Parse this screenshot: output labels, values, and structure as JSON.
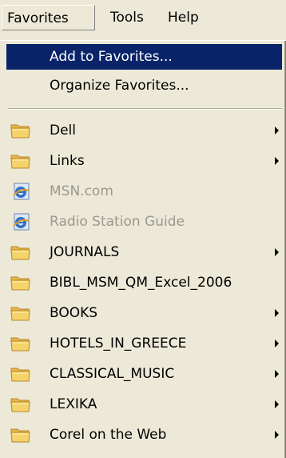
{
  "menubar": {
    "items": [
      "Favorites",
      "Tools",
      "Help"
    ]
  },
  "dropdown": {
    "commands": [
      "Add to Favorites...",
      "Organize Favorites..."
    ],
    "entries": [
      {
        "label": "Dell",
        "icon": "folder-icon",
        "submenu": true,
        "disabled": false
      },
      {
        "label": "Links",
        "icon": "folder-icon",
        "submenu": true,
        "disabled": false
      },
      {
        "label": "MSN.com",
        "icon": "ie-page-icon",
        "submenu": false,
        "disabled": true
      },
      {
        "label": "Radio Station Guide",
        "icon": "ie-page-icon",
        "submenu": false,
        "disabled": true
      },
      {
        "label": "JOURNALS",
        "icon": "folder-icon",
        "submenu": true,
        "disabled": false
      },
      {
        "label": "BIBL_MSM_QM_Excel_2006",
        "icon": "folder-icon",
        "submenu": false,
        "disabled": false
      },
      {
        "label": "BOOKS",
        "icon": "folder-icon",
        "submenu": true,
        "disabled": false
      },
      {
        "label": "HOTELS_IN_GREECE",
        "icon": "folder-icon",
        "submenu": true,
        "disabled": false
      },
      {
        "label": "CLASSICAL_MUSIC",
        "icon": "folder-icon",
        "submenu": true,
        "disabled": false
      },
      {
        "label": "LEXIKA",
        "icon": "folder-icon",
        "submenu": true,
        "disabled": false
      },
      {
        "label": "Corel on the Web",
        "icon": "folder-icon",
        "submenu": true,
        "disabled": false
      }
    ]
  },
  "colors": {
    "highlight": "#0a246a",
    "menu_bg": "#ece9d8",
    "disabled_text": "#9a9890",
    "folder": "#f4d36a"
  }
}
